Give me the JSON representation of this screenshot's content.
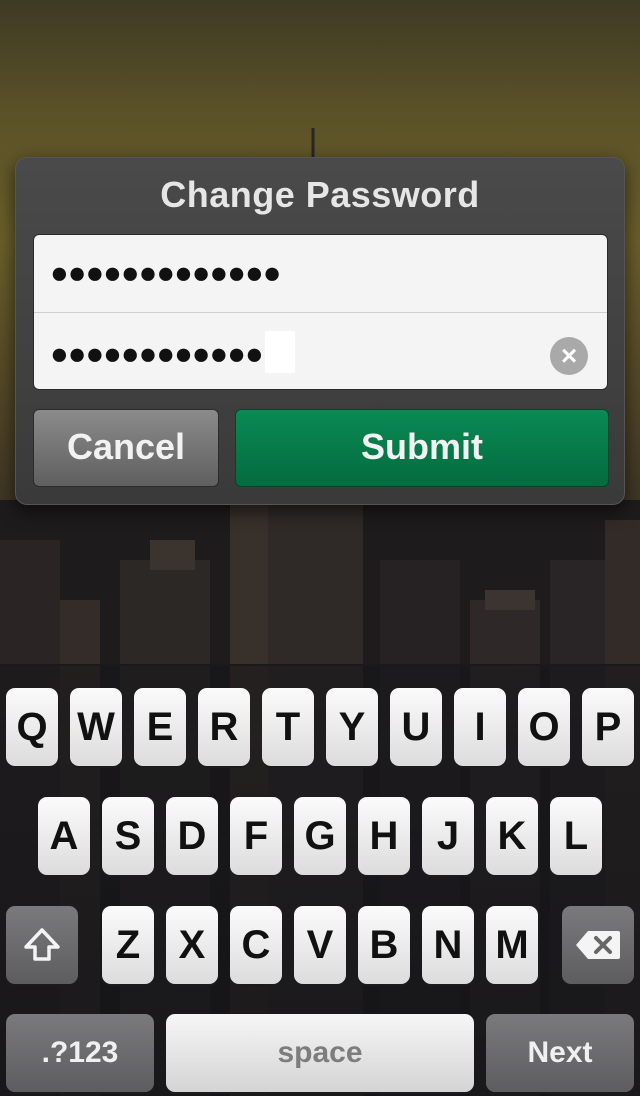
{
  "dialog": {
    "title": "Change Password",
    "password_field_1": "●●●●●●●●●●●●●",
    "password_field_2": "●●●●●●●●●●●●",
    "cancel_label": "Cancel",
    "submit_label": "Submit",
    "submit_color": "#0a7a4a"
  },
  "keyboard": {
    "row1": [
      "Q",
      "W",
      "E",
      "R",
      "T",
      "Y",
      "U",
      "I",
      "O",
      "P"
    ],
    "row2": [
      "A",
      "S",
      "D",
      "F",
      "G",
      "H",
      "J",
      "K",
      "L"
    ],
    "row3": [
      "Z",
      "X",
      "C",
      "V",
      "B",
      "N",
      "M"
    ],
    "numbers_label": ".?123",
    "space_label": "space",
    "next_label": "Next",
    "shift_icon": "shift-arrow-icon",
    "backspace_icon": "backspace-icon"
  }
}
